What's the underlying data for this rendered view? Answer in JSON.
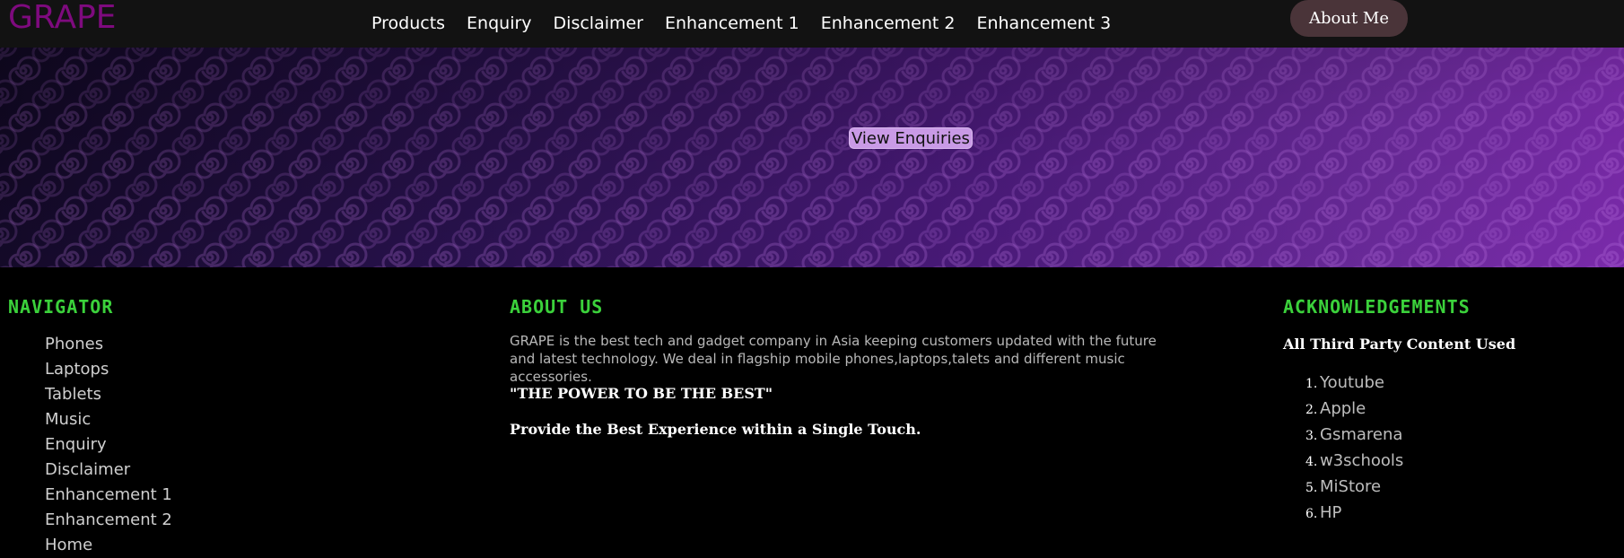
{
  "header": {
    "logo": "GRAPE",
    "nav": [
      "Products",
      "Enquiry",
      "Disclaimer",
      "Enhancement 1",
      "Enhancement 2",
      "Enhancement 3"
    ],
    "about_button": "About Me"
  },
  "hero": {
    "button_label": "View Enquiries"
  },
  "navigator": {
    "title": "NAVIGATOR",
    "items": [
      "Phones",
      "Laptops",
      "Tablets",
      "Music",
      "Enquiry",
      "Disclaimer",
      "Enhancement 1",
      "Enhancement 2",
      "Home"
    ]
  },
  "about": {
    "title": "ABOUT US",
    "text": "GRAPE is the best tech and gadget company in Asia keeping customers updated with the future and latest technology. We deal in flagship mobile phones,laptops,talets and different music accessories.",
    "quote": "\"THE POWER TO BE THE BEST\"",
    "tagline": "Provide the Best Experience within a Single Touch."
  },
  "acknowledgements": {
    "title": "ACKNOWLEDGEMENTS",
    "subtitle": "All Third Party Content Used",
    "items": [
      "Youtube",
      "Apple",
      "Gsmarena",
      "w3schools",
      "MiStore",
      "HP"
    ]
  },
  "colors": {
    "logo": "#7e0a7e",
    "section_title": "#3bd13b",
    "about_button_bg": "#4a3439",
    "hero_button_bg": "#c99ae6"
  }
}
